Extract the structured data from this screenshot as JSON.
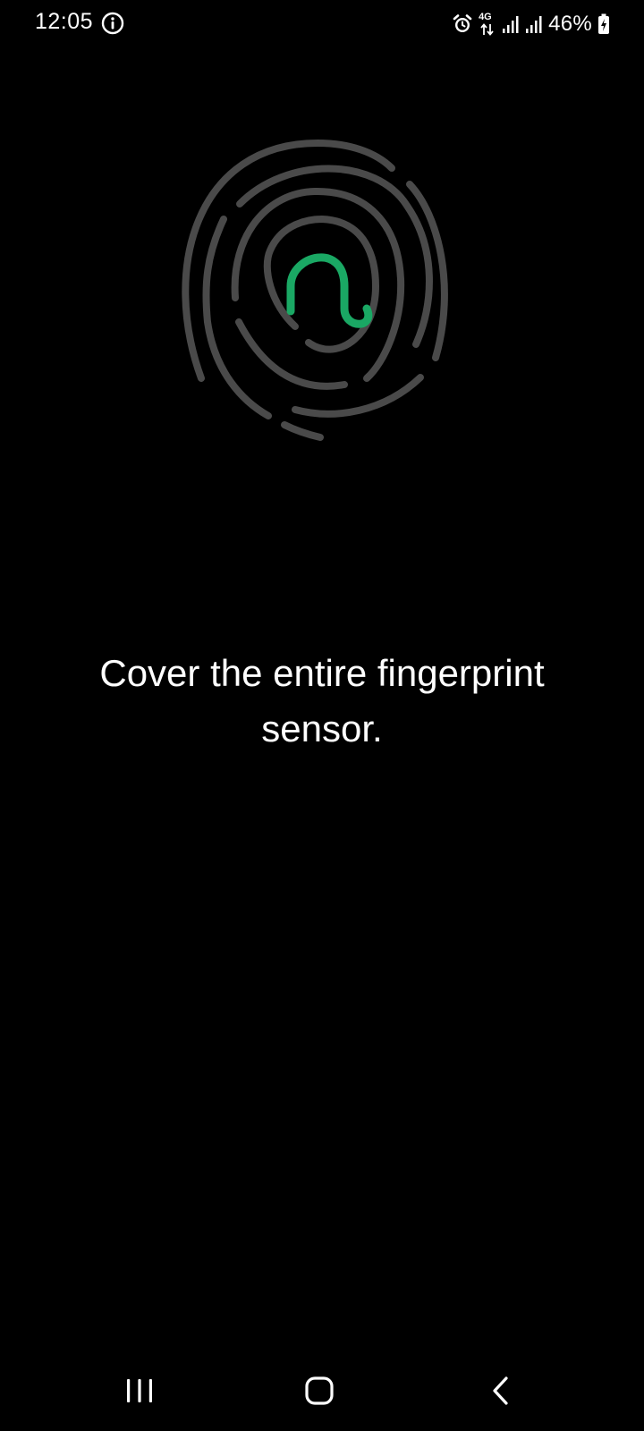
{
  "status_bar": {
    "time": "12:05",
    "info_icon": "info-circle-icon",
    "alarm_icon": "alarm-clock-icon",
    "network_type": "4G",
    "signal_icons": [
      "signal-1-icon",
      "signal-2-icon"
    ],
    "battery_percent": "46%",
    "battery_icon": "battery-charging-icon"
  },
  "fingerprint": {
    "icon": "fingerprint-icon",
    "ridge_color": "#4a4a4a",
    "progress_color": "#1aa864"
  },
  "instruction": {
    "text": "Cover the entire fingerprint sensor."
  },
  "nav_bar": {
    "recents_icon": "recent-apps-icon",
    "home_icon": "home-icon",
    "back_icon": "back-icon"
  }
}
